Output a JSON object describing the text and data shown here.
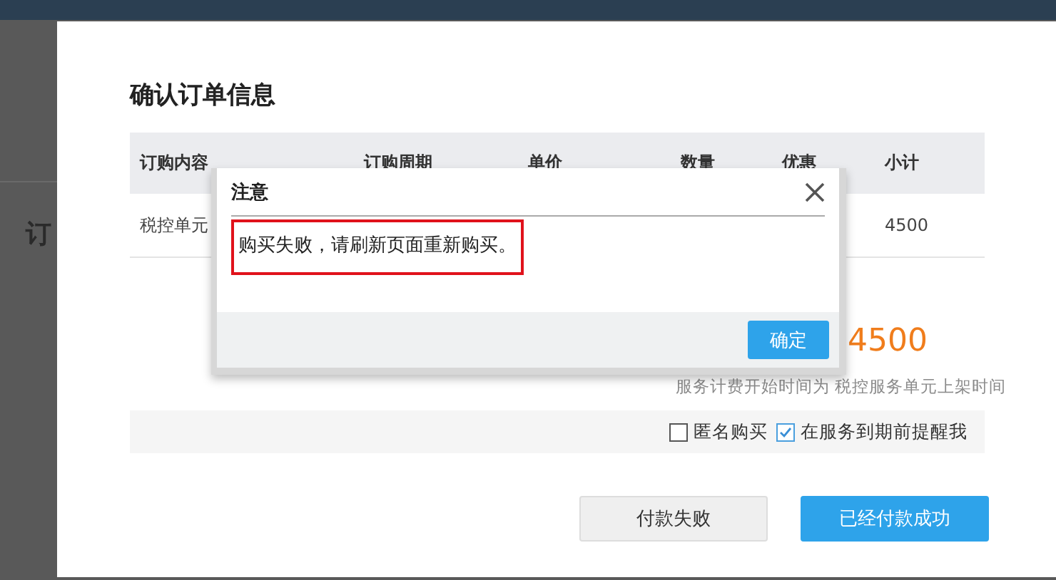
{
  "background": {
    "heading": "订"
  },
  "order_modal": {
    "title": "确认订单信息",
    "table": {
      "columns": [
        "订购内容",
        "订购周期",
        "单价",
        "数量",
        "优惠",
        "小计"
      ],
      "rows": [
        {
          "content": "税控单元",
          "subtotal": "4500"
        }
      ]
    },
    "total": "4500",
    "note": "服务计费开始时间为 税控服务单元上架时间",
    "options": [
      {
        "label": "匿名购买",
        "checked": false
      },
      {
        "label": "在服务到期前提醒我",
        "checked": true
      }
    ],
    "buttons": [
      {
        "label": "付款失败",
        "kind": "secondary"
      },
      {
        "label": "已经付款成功",
        "kind": "primary"
      }
    ]
  },
  "alert_dialog": {
    "title": "注意",
    "message": "购买失败，请刷新页面重新购买。",
    "confirm": "确定"
  }
}
